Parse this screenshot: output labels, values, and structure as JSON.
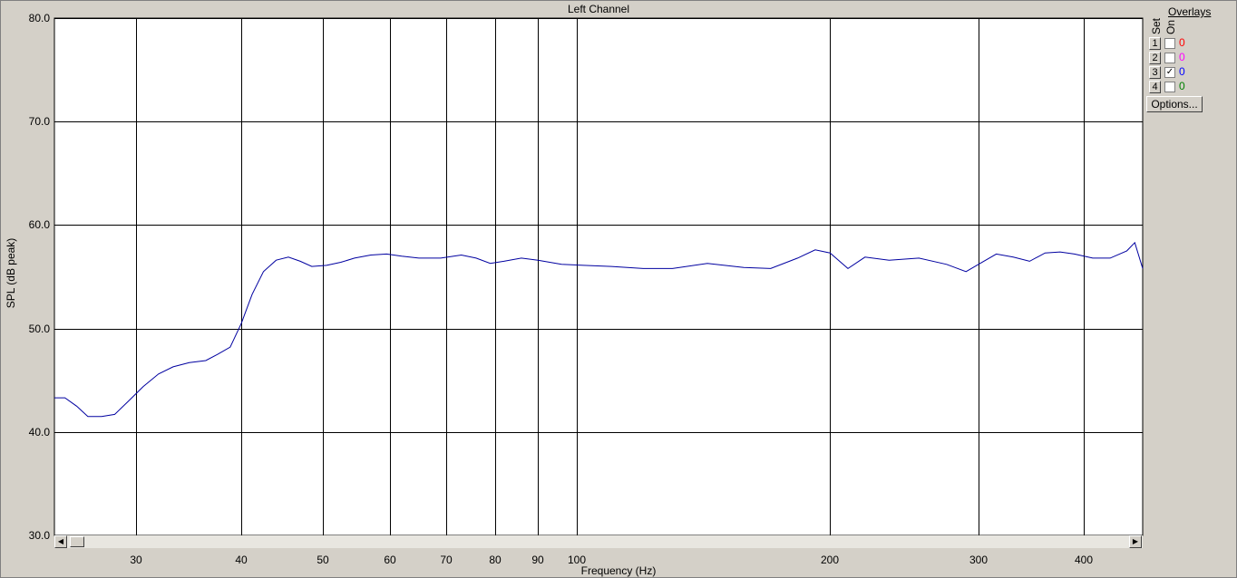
{
  "chart_data": {
    "type": "line",
    "title": "Left Channel",
    "xlabel": "Frequency (Hz)",
    "ylabel": "SPL (dB peak)",
    "x_scale": "log",
    "xlim": [
      24,
      470
    ],
    "ylim": [
      30,
      80
    ],
    "grid": true,
    "xticks": [
      30,
      40,
      50,
      60,
      70,
      80,
      90,
      100,
      200,
      300,
      400
    ],
    "yticks": [
      30.0,
      40.0,
      50.0,
      60.0,
      70.0,
      80.0
    ],
    "ytick_labels": [
      "30.0",
      "40.0",
      "50.0",
      "60.0",
      "70.0",
      "80.0"
    ],
    "series": [
      {
        "color": "#0000a0",
        "x": [
          24.0,
          24.7,
          25.5,
          26.3,
          27.3,
          28.3,
          29.4,
          30.6,
          31.9,
          33.2,
          34.7,
          36.3,
          37.5,
          38.8,
          40.0,
          41.2,
          42.5,
          44.0,
          45.5,
          47.0,
          48.5,
          50.5,
          52.5,
          54.5,
          57.0,
          59.5,
          62.0,
          65.0,
          69.0,
          73.0,
          76.0,
          79.0,
          82.0,
          86.0,
          90.0,
          96.0,
          102.0,
          110.0,
          120.0,
          130.0,
          143.0,
          158.0,
          170.0,
          183.0,
          192.0,
          200.0,
          210.0,
          220.0,
          235.0,
          255.0,
          275.0,
          290.0,
          300.0,
          315.0,
          330.0,
          345.0,
          360.0,
          375.0,
          390.0,
          410.0,
          430.0,
          450.0,
          460.0,
          470.0
        ],
        "y": [
          43.3,
          43.3,
          42.5,
          41.5,
          41.5,
          41.7,
          43.0,
          44.4,
          45.6,
          46.3,
          46.7,
          46.9,
          47.5,
          48.2,
          50.5,
          53.3,
          55.5,
          56.6,
          56.9,
          56.5,
          56.0,
          56.1,
          56.4,
          56.8,
          57.1,
          57.2,
          57.0,
          56.8,
          56.8,
          57.1,
          56.8,
          56.3,
          56.5,
          56.8,
          56.6,
          56.2,
          56.1,
          56.0,
          55.8,
          55.8,
          56.3,
          55.9,
          55.8,
          56.8,
          57.6,
          57.3,
          55.8,
          56.9,
          56.6,
          56.8,
          56.2,
          55.5,
          56.2,
          57.2,
          56.9,
          56.5,
          57.3,
          57.4,
          57.2,
          56.8,
          56.8,
          57.5,
          58.3,
          55.8
        ]
      }
    ]
  },
  "overlays": {
    "title": "Overlays",
    "set_header": "Set",
    "on_header": "On",
    "rows": [
      {
        "set": "1",
        "checked": "",
        "count": "0",
        "color": "#ff0000"
      },
      {
        "set": "2",
        "checked": "",
        "count": "0",
        "color": "#ff00ff"
      },
      {
        "set": "3",
        "checked": "✓",
        "count": "0",
        "color": "#0000ff"
      },
      {
        "set": "4",
        "checked": "",
        "count": "0",
        "color": "#008000"
      }
    ],
    "options_label": "Options..."
  },
  "scrollbar": {
    "left_icon": "scroll-left-arrow-icon",
    "right_icon": "scroll-right-arrow-icon"
  }
}
